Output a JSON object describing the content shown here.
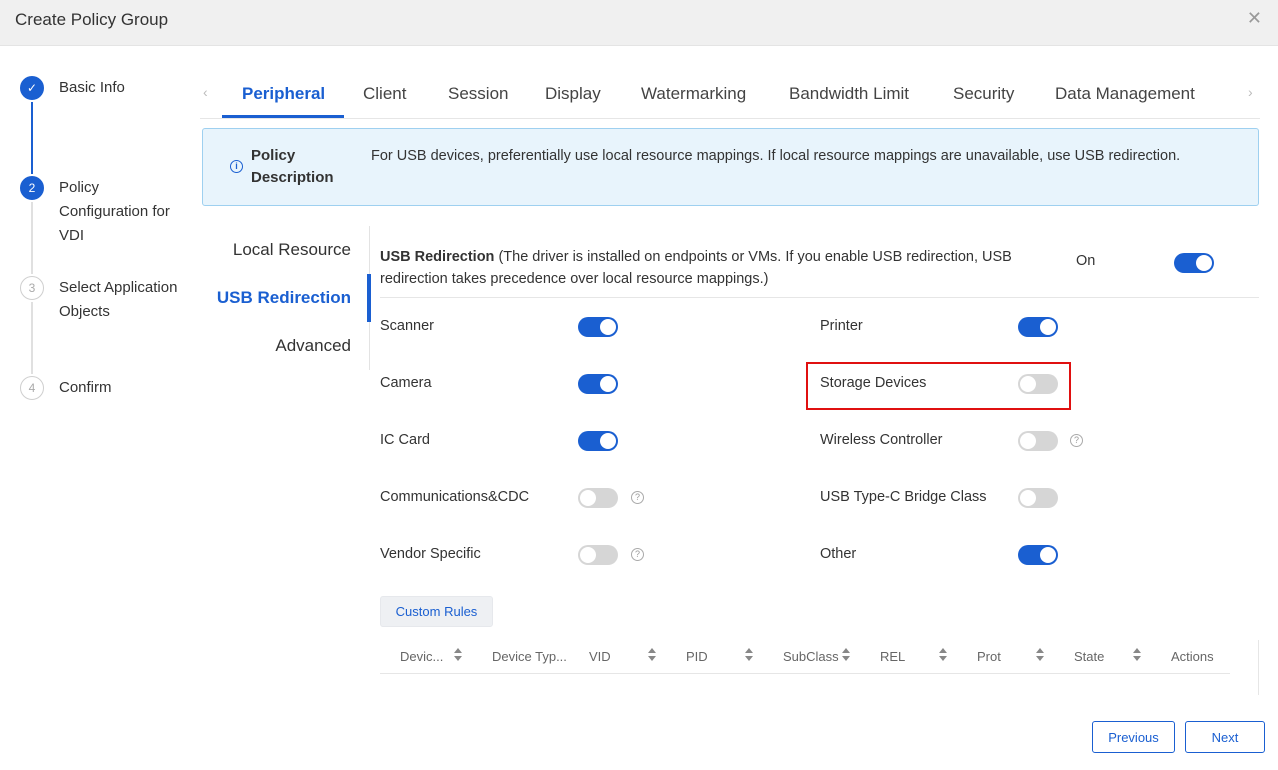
{
  "dialog": {
    "title": "Create Policy Group"
  },
  "steps": [
    {
      "num": "✓",
      "label": "Basic Info"
    },
    {
      "num": "2",
      "label": "Policy Configuration for VDI"
    },
    {
      "num": "3",
      "label": "Select Application Objects"
    },
    {
      "num": "4",
      "label": "Confirm"
    }
  ],
  "tabs": [
    "Peripheral",
    "Client",
    "Session",
    "Display",
    "Watermarking",
    "Bandwidth Limit",
    "Security",
    "Data Management"
  ],
  "description": {
    "label": "Policy Description",
    "text": "For USB devices, preferentially use local resource mappings. If local resource mappings are unavailable, use USB redirection."
  },
  "subnav": [
    "Local Resource",
    "USB Redirection",
    "Advanced"
  ],
  "usb": {
    "title": "USB Redirection",
    "note": " (The driver is installed on endpoints or VMs. If you enable USB redirection, USB redirection takes precedence over local resource mappings.)",
    "state_label": "On",
    "enabled": true
  },
  "devices": [
    {
      "label": "Scanner",
      "on": true,
      "help": false
    },
    {
      "label": "Printer",
      "on": true,
      "help": false
    },
    {
      "label": "Camera",
      "on": true,
      "help": false
    },
    {
      "label": "Storage Devices",
      "on": false,
      "help": false
    },
    {
      "label": "IC Card",
      "on": true,
      "help": false
    },
    {
      "label": "Wireless Controller",
      "on": false,
      "help": true
    },
    {
      "label": "Communications&CDC",
      "on": false,
      "help": true
    },
    {
      "label": "USB Type-C Bridge Class",
      "on": false,
      "help": false
    },
    {
      "label": "Vendor Specific",
      "on": false,
      "help": true
    },
    {
      "label": "Other",
      "on": true,
      "help": false
    }
  ],
  "custom_rules_label": "Custom Rules",
  "table": {
    "columns": [
      "Devic...",
      "Device Typ...",
      "VID",
      "PID",
      "SubClass",
      "REL",
      "Prot",
      "State",
      "Actions"
    ]
  },
  "footer": {
    "previous": "Previous",
    "next": "Next"
  },
  "colors": {
    "accent": "#1a5fd1",
    "highlight": "#e01010",
    "info_bg": "#e8f4fc"
  }
}
